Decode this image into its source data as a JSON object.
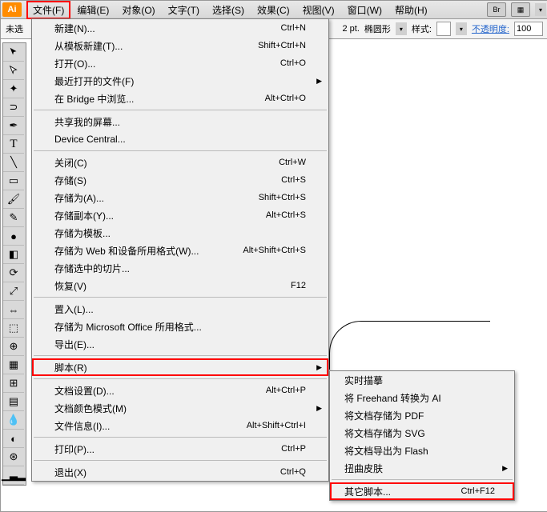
{
  "app": {
    "logo": "Ai"
  },
  "menubar": {
    "file": "文件(F)",
    "edit": "编辑(E)",
    "object": "对象(O)",
    "type": "文字(T)",
    "select": "选择(S)",
    "effect": "效果(C)",
    "view": "视图(V)",
    "window": "窗口(W)",
    "help": "帮助(H)",
    "br": "Br"
  },
  "optbar": {
    "doc": "未选",
    "stroke": "2 pt.",
    "profile": "椭圆形",
    "style_lbl": "样式:",
    "opacity_lbl": "不透明度:",
    "opacity_val": "100"
  },
  "file": {
    "new": {
      "l": "新建(N)...",
      "s": "Ctrl+N"
    },
    "newtpl": {
      "l": "从模板新建(T)...",
      "s": "Shift+Ctrl+N"
    },
    "open": {
      "l": "打开(O)...",
      "s": "Ctrl+O"
    },
    "recent": {
      "l": "最近打开的文件(F)"
    },
    "bridge": {
      "l": "在 Bridge 中浏览...",
      "s": "Alt+Ctrl+O"
    },
    "share": {
      "l": "共享我的屏幕..."
    },
    "device": {
      "l": "Device Central..."
    },
    "close": {
      "l": "关闭(C)",
      "s": "Ctrl+W"
    },
    "save": {
      "l": "存储(S)",
      "s": "Ctrl+S"
    },
    "saveas": {
      "l": "存储为(A)...",
      "s": "Shift+Ctrl+S"
    },
    "savecopy": {
      "l": "存储副本(Y)...",
      "s": "Alt+Ctrl+S"
    },
    "savetpl": {
      "l": "存储为模板..."
    },
    "saveweb": {
      "l": "存储为 Web 和设备所用格式(W)...",
      "s": "Alt+Shift+Ctrl+S"
    },
    "saveslices": {
      "l": "存储选中的切片..."
    },
    "revert": {
      "l": "恢复(V)",
      "s": "F12"
    },
    "place": {
      "l": "置入(L)..."
    },
    "saveoffice": {
      "l": "存储为 Microsoft Office 所用格式..."
    },
    "export": {
      "l": "导出(E)..."
    },
    "scripts": {
      "l": "脚本(R)"
    },
    "docsetup": {
      "l": "文档设置(D)...",
      "s": "Alt+Ctrl+P"
    },
    "colormode": {
      "l": "文档颜色模式(M)"
    },
    "fileinfo": {
      "l": "文件信息(I)...",
      "s": "Alt+Shift+Ctrl+I"
    },
    "print": {
      "l": "打印(P)...",
      "s": "Ctrl+P"
    },
    "exit": {
      "l": "退出(X)",
      "s": "Ctrl+Q"
    }
  },
  "scripts": {
    "trace": "实时描摹",
    "freehand": "将 Freehand 转换为 AI",
    "pdf": "将文档存储为 PDF",
    "svg": "将文档存储为 SVG",
    "flash": "将文档导出为 Flash",
    "warp": "扭曲皮肤",
    "other": {
      "l": "其它脚本...",
      "s": "Ctrl+F12"
    }
  }
}
